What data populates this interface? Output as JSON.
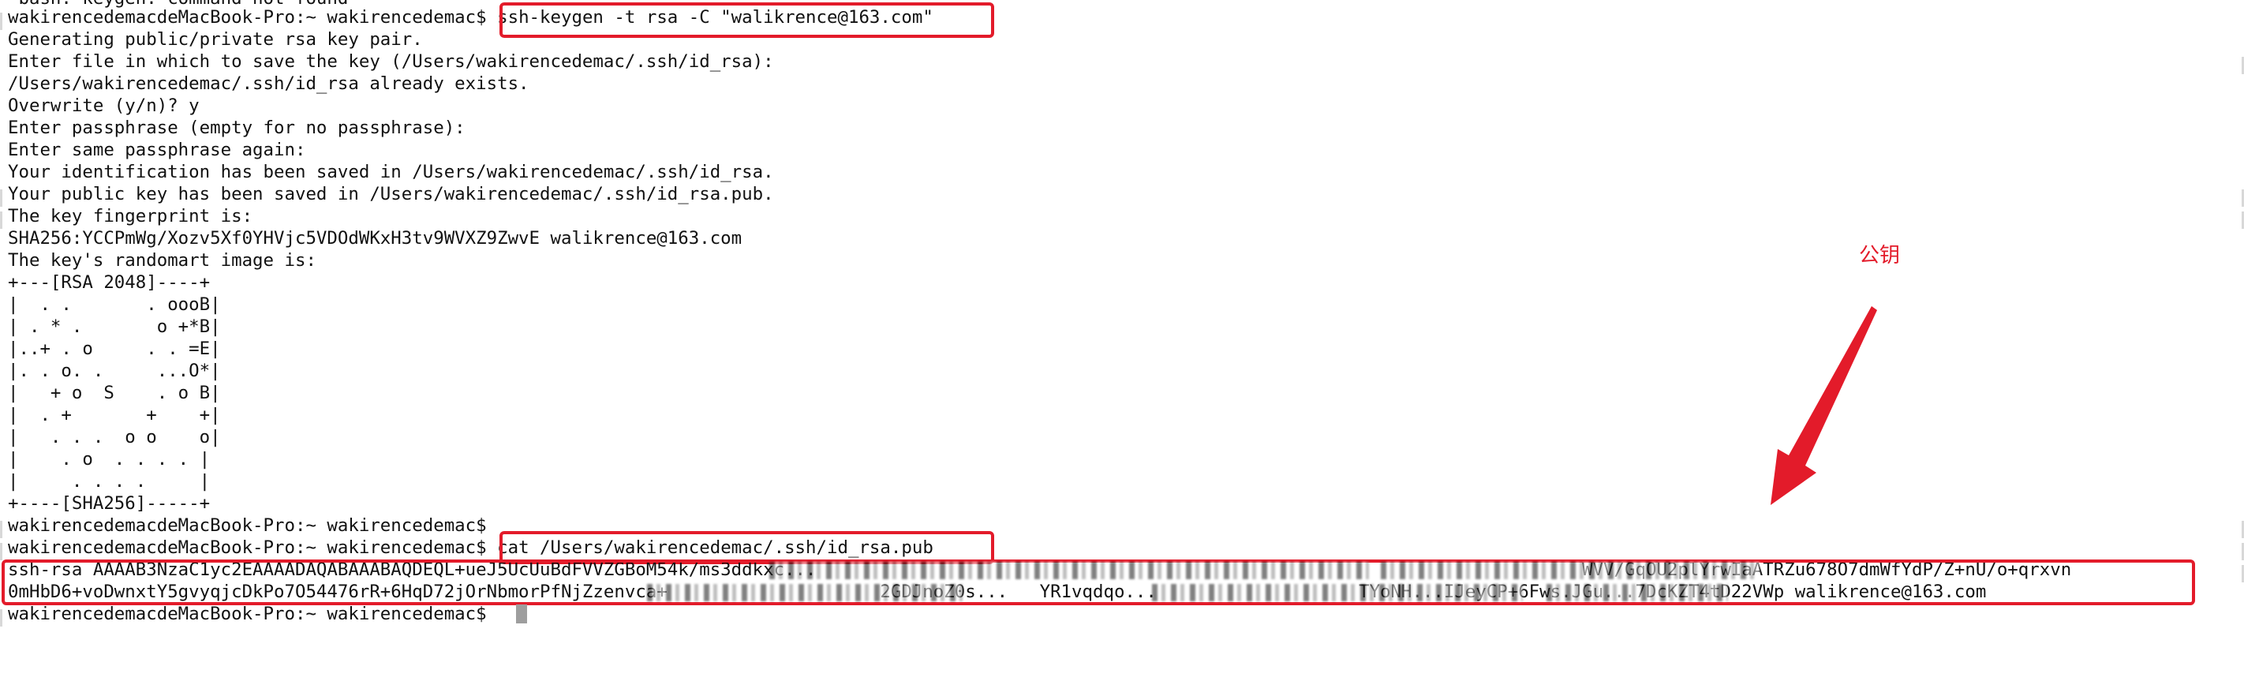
{
  "terminal": {
    "header_fragment": "-bash: keygen: command not found",
    "commands": {
      "prompt": "wakirencedemacdeMacBook-Pro:~ wakirencedemac$",
      "ssh_keygen_prompt": "wakirencedemacdeMacBook-Pro:~ wakirencedemac$ ",
      "ssh_keygen_command": "ssh-keygen -t rsa -C \"walikrence@163.com\"",
      "cat_prompt": "wakirencedemacdeMacBook-Pro:~ wakirencedemac$ ",
      "cat_command": "cat /Users/wakirencedemac/.ssh/id_rsa.pub",
      "blank_prompt_1": "wakirencedemacdeMacBook-Pro:~ wakirencedemac$",
      "final_prompt": "wakirencedemacdeMacBook-Pro:~ wakirencedemac$ "
    },
    "output": [
      "Generating public/private rsa key pair.",
      "Enter file in which to save the key (/Users/wakirencedemac/.ssh/id_rsa):",
      "/Users/wakirencedemac/.ssh/id_rsa already exists.",
      "Overwrite (y/n)? y",
      "Enter passphrase (empty for no passphrase):",
      "Enter same passphrase again:",
      "Your identification has been saved in /Users/wakirencedemac/.ssh/id_rsa.",
      "Your public key has been saved in /Users/wakirencedemac/.ssh/id_rsa.pub.",
      "The key fingerprint is:",
      "SHA256:YCCPmWg/Xozv5Xf0YHVjc5VDOdWKxH3tv9WVXZ9ZwvE walikrence@163.com",
      "The key's randomart image is:"
    ],
    "randomart": [
      "+---[RSA 2048]----+",
      "|  . .       . oooB|",
      "| . * .       o +*B|",
      "|..+ . o     . . =E|",
      "|. . o. .     ...O*|",
      "|   + o  S    . o B|",
      "|  . +       +    +|",
      "|   . . .  o o    o|",
      "|    . o  . . . . |",
      "|     . . . .     |",
      "+----[SHA256]-----+"
    ],
    "public_key_line_1": "ssh-rsa AAAAB3NzaC1yc2EAAAADAQABAAABAQDEQL+ueJ5UcUuBdFVVZGBoM54k/ms3ddkxc...                                                                        WVV/GqOU2plYrwIaATRZu678O7dmWfYdP/Z+nU/o+qrxvn",
    "public_key_line_2": "0mHbD6+voDwnxtY5gvyqjcDkPo7O54476rR+6HqD72jOrNbmorPfNjZzenvca+                    2GDJnoZ0s...   YR1vqdqo...                   TYoNH...IJeyCP+6Fws.JGu...7DcKZT4tD22VWp walikrence@163.com",
    "annotation_label": "公钥"
  },
  "colors": {
    "highlight": "#e31b2a",
    "text": "#111111",
    "cursor": "#9e9e9e",
    "background": "#ffffff"
  }
}
